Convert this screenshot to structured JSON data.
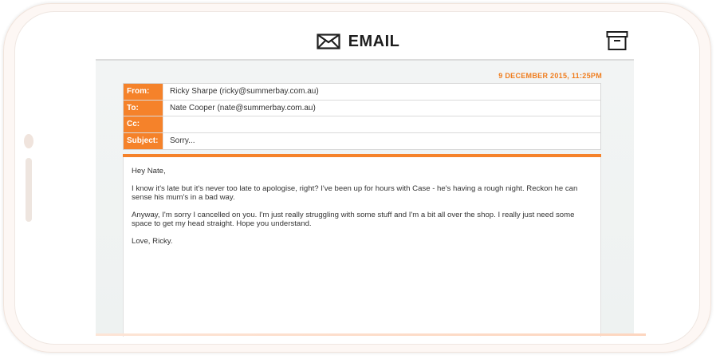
{
  "app": {
    "title": "EMAIL",
    "icons": {
      "header": "envelope-icon",
      "action": "archive-icon"
    }
  },
  "email": {
    "date": "9 DECEMBER 2015, 11:25PM",
    "fields": [
      {
        "label": "From:",
        "value": "Ricky Sharpe (ricky@summerbay.com.au)"
      },
      {
        "label": "To:",
        "value": "Nate Cooper (nate@summerbay.com.au)"
      },
      {
        "label": "Cc:",
        "value": ""
      },
      {
        "label": "Subject:",
        "value": "Sorry..."
      }
    ],
    "body": [
      "Hey Nate,",
      "I know it's late but it's never too late to apologise, right? I've been up for hours with Case - he's having a rough night. Reckon he can sense his mum's in a bad way.",
      "Anyway, I'm sorry I cancelled on you. I'm just really struggling with some stuff and I'm a bit all over the shop. I really just need some space to get my head straight. Hope you understand.",
      "Love, Ricky."
    ]
  },
  "colors": {
    "accent": "#f5822a",
    "date_text": "#f07d1e",
    "title_text": "#1e1e1e"
  }
}
